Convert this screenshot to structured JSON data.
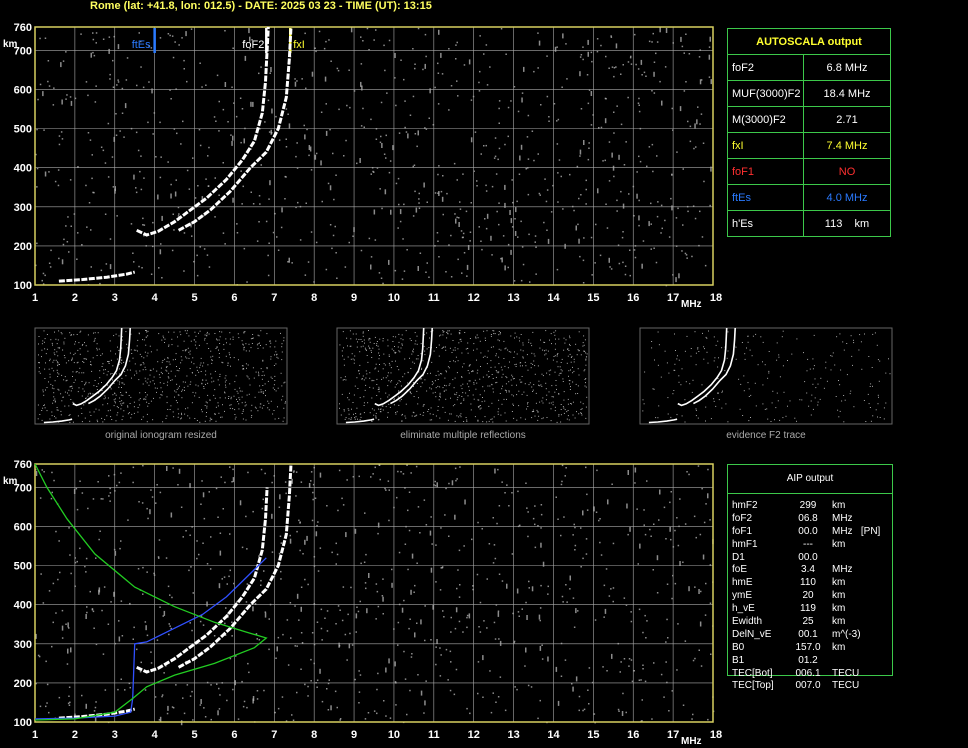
{
  "header": "Rome (lat: +41.8, lon: 012.5) - DATE: 2025 03 23 - TIME (UT): 13:15",
  "colors": {
    "axis": "#d8d060",
    "grid": "#aaaaaa",
    "trace": "#ffffff",
    "profile": "#22cc22",
    "inverted": "#3050ff",
    "table": "#3cc84a",
    "fxI": "#ffff30",
    "foF1": "#ff3030",
    "ftEs": "#2a7aff"
  },
  "chart_data": [
    {
      "type": "scatter",
      "title": "",
      "xlabel": "MHz",
      "ylabel": "km",
      "xlim": [
        1,
        18
      ],
      "ylim": [
        100,
        760
      ],
      "x_ticks": [
        "1",
        "2",
        "3",
        "4",
        "5",
        "6",
        "7",
        "8",
        "9",
        "10",
        "11",
        "12",
        "13",
        "14",
        "15",
        "16",
        "17",
        "18"
      ],
      "y_ticks": [
        "100",
        "200",
        "300",
        "400",
        "500",
        "600",
        "700",
        "760"
      ],
      "grid": true,
      "markers": [
        {
          "label": "ftEs",
          "x": 4.0,
          "color": "#2a7aff"
        },
        {
          "label": "foF2",
          "x": 6.8,
          "color": "#ffffff"
        },
        {
          "label": "fxI",
          "x": 7.4,
          "color": "#ffff30"
        }
      ],
      "series": [
        {
          "trace": "ordinary",
          "color": "#ffffff",
          "points": [
            [
              3.55,
              240
            ],
            [
              3.8,
              228
            ],
            [
              4.1,
              238
            ],
            [
              4.5,
              262
            ],
            [
              4.9,
              292
            ],
            [
              5.3,
              322
            ],
            [
              5.8,
              370
            ],
            [
              6.2,
              420
            ],
            [
              6.5,
              468
            ],
            [
              6.7,
              540
            ],
            [
              6.78,
              620
            ],
            [
              6.82,
              700
            ],
            [
              6.85,
              760
            ]
          ]
        },
        {
          "trace": "extraordinary",
          "color": "#ffffff",
          "points": [
            [
              4.6,
              240
            ],
            [
              5.0,
              262
            ],
            [
              5.4,
              292
            ],
            [
              5.9,
              340
            ],
            [
              6.4,
              400
            ],
            [
              6.8,
              440
            ],
            [
              7.1,
              500
            ],
            [
              7.3,
              580
            ],
            [
              7.38,
              680
            ],
            [
              7.42,
              760
            ]
          ]
        },
        {
          "trace": "Es",
          "color": "#ffffff",
          "points": [
            [
              1.6,
              110
            ],
            [
              2.2,
              114
            ],
            [
              2.8,
              120
            ],
            [
              3.3,
              128
            ],
            [
              3.5,
              133
            ]
          ]
        }
      ]
    },
    {
      "type": "line",
      "title": "",
      "xlabel": "MHz",
      "ylabel": "km",
      "xlim": [
        1,
        18
      ],
      "ylim": [
        100,
        760
      ],
      "x_ticks": [
        "1",
        "2",
        "3",
        "4",
        "5",
        "6",
        "7",
        "8",
        "9",
        "10",
        "11",
        "12",
        "13",
        "14",
        "15",
        "16",
        "17",
        "18"
      ],
      "y_ticks": [
        "100",
        "200",
        "300",
        "400",
        "500",
        "600",
        "700",
        "760"
      ],
      "grid": true,
      "series": [
        {
          "trace": "ordinary",
          "color": "#ffffff",
          "points": [
            [
              3.55,
              240
            ],
            [
              3.8,
              228
            ],
            [
              4.1,
              238
            ],
            [
              4.5,
              262
            ],
            [
              4.9,
              292
            ],
            [
              5.3,
              322
            ],
            [
              5.8,
              370
            ],
            [
              6.2,
              420
            ],
            [
              6.5,
              468
            ],
            [
              6.7,
              540
            ],
            [
              6.78,
              620
            ],
            [
              6.82,
              700
            ]
          ]
        },
        {
          "trace": "extraordinary",
          "color": "#ffffff",
          "points": [
            [
              4.6,
              240
            ],
            [
              5.0,
              262
            ],
            [
              5.4,
              292
            ],
            [
              5.9,
              340
            ],
            [
              6.4,
              400
            ],
            [
              6.8,
              440
            ],
            [
              7.1,
              500
            ],
            [
              7.3,
              580
            ],
            [
              7.38,
              680
            ],
            [
              7.42,
              760
            ]
          ]
        },
        {
          "trace": "Es",
          "color": "#ffffff",
          "points": [
            [
              1.6,
              110
            ],
            [
              2.2,
              114
            ],
            [
              2.8,
              120
            ],
            [
              3.3,
              128
            ],
            [
              3.5,
              133
            ]
          ]
        },
        {
          "trace": "inverted profile",
          "color": "#3050ff",
          "points": [
            [
              1.0,
              108
            ],
            [
              2.0,
              110
            ],
            [
              3.0,
              115
            ],
            [
              3.4,
              125
            ],
            [
              3.45,
              160
            ],
            [
              3.5,
              300
            ],
            [
              3.8,
              305
            ],
            [
              4.5,
              340
            ],
            [
              5.2,
              375
            ],
            [
              5.8,
              420
            ],
            [
              6.3,
              470
            ],
            [
              6.8,
              520
            ]
          ]
        },
        {
          "trace": "model profile",
          "color": "#22cc22",
          "points": [
            [
              1.0,
              760
            ],
            [
              1.3,
              700
            ],
            [
              1.8,
              620
            ],
            [
              2.5,
              530
            ],
            [
              3.5,
              445
            ],
            [
              4.5,
              395
            ],
            [
              5.5,
              355
            ],
            [
              6.3,
              330
            ],
            [
              6.8,
              315
            ],
            [
              6.5,
              290
            ],
            [
              5.5,
              250
            ],
            [
              4.5,
              220
            ],
            [
              3.8,
              190
            ],
            [
              3.45,
              160
            ],
            [
              3.0,
              125
            ],
            [
              2.0,
              108
            ],
            [
              1.0,
              105
            ]
          ]
        }
      ]
    }
  ],
  "thumbnails": [
    {
      "caption": "original ionogram resized"
    },
    {
      "caption": "eliminate multiple reflections"
    },
    {
      "caption": "evidence F2 trace"
    }
  ],
  "autoscala": {
    "title": "AUTOSCALA output",
    "rows": [
      {
        "key": "foF2",
        "value": "6.8 MHz",
        "color": "#ffffff"
      },
      {
        "key": "MUF(3000)F2",
        "value": "18.4 MHz",
        "color": "#ffffff"
      },
      {
        "key": "M(3000)F2",
        "value": "2.71",
        "color": "#ffffff"
      },
      {
        "key": "fxI",
        "value": "7.4 MHz",
        "color": "#ffff30"
      },
      {
        "key": "foF1",
        "value": "NO",
        "color": "#ff3030"
      },
      {
        "key": "ftEs",
        "value": "4.0 MHz",
        "color": "#2a7aff"
      },
      {
        "key": "h'Es",
        "value": "113    km",
        "color": "#ffffff"
      }
    ]
  },
  "aip": {
    "title": "AIP output",
    "rows": [
      {
        "k": "hmF2",
        "v": "299",
        "u": "km"
      },
      {
        "k": "foF2",
        "v": "06.8",
        "u": "MHz"
      },
      {
        "k": "foF1",
        "v": "00.0",
        "u": "MHz   [PN]"
      },
      {
        "k": "hmF1",
        "v": "---",
        "u": "km"
      },
      {
        "k": "D1",
        "v": "00.0",
        "u": ""
      },
      {
        "k": "foE",
        "v": "3.4",
        "u": "MHz"
      },
      {
        "k": "hmE",
        "v": "110",
        "u": "km"
      },
      {
        "k": "ymE",
        "v": "20",
        "u": "km"
      },
      {
        "k": "h_vE",
        "v": "119",
        "u": "km"
      },
      {
        "k": "Ewidth",
        "v": "25",
        "u": "km"
      },
      {
        "k": "DelN_vE",
        "v": "00.1",
        "u": "m^(-3)"
      },
      {
        "k": "B0",
        "v": "157.0",
        "u": "km"
      },
      {
        "k": "B1",
        "v": "01.2",
        "u": ""
      },
      {
        "k": "TEC[Bot]",
        "v": "006.1",
        "u": "TECU"
      },
      {
        "k": "TEC[Top]",
        "v": "007.0",
        "u": "TECU"
      }
    ]
  }
}
